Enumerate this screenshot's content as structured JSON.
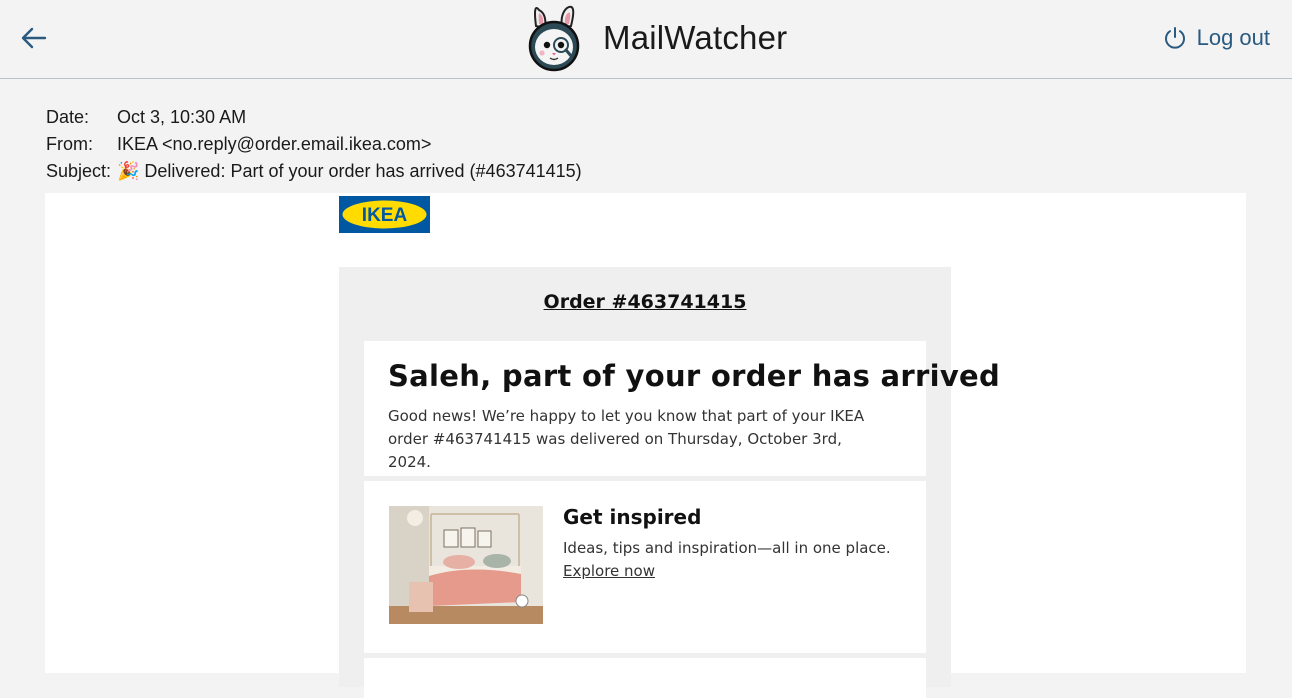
{
  "app": {
    "title": "MailWatcher",
    "logout_label": "Log out",
    "back_icon": "arrow-left-icon",
    "logout_icon": "power-icon",
    "accent_color": "#2a5a80"
  },
  "headers": {
    "date_label": "Date:",
    "date_value": "Oct 3, 10:30 AM",
    "from_label": "From:",
    "from_value": "IKEA <no.reply@order.email.ikea.com>",
    "subject_label": "Subject:",
    "subject_value": "🎉 Delivered: Part of your order has arrived (#463741415)"
  },
  "email": {
    "brand_logo_text": "IKEA",
    "brand_colors": {
      "blue": "#0058a3",
      "yellow": "#ffdb00"
    },
    "order_number": "Order #463741415",
    "headline": "Saleh, part of your order has arrived",
    "intro": "Good news! We’re happy to let you know that part of your IKEA order #463741415 was delivered on Thursday, October 3rd, 2024.",
    "inspire": {
      "title": "Get inspired",
      "text": "Ideas, tips and inspiration—all in one place.",
      "link_label": "Explore now"
    }
  }
}
